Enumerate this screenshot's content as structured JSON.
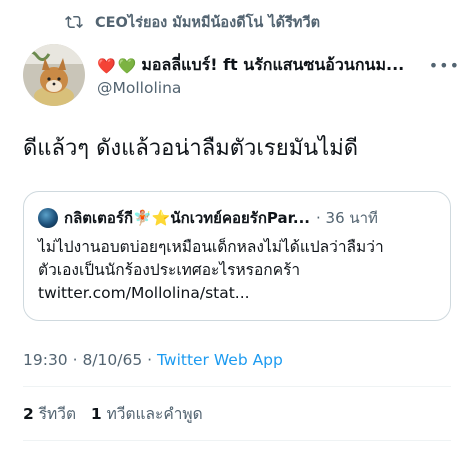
{
  "retweet": {
    "label": "CEOไร่ยอง มัมหมีน้องดีโน่ ได้รีทวีต"
  },
  "author": {
    "emoji_1": "❤️",
    "emoji_2": "💚",
    "name": "มอลลี่แบร์! ft นรักแสนซนอ้วนกนม...",
    "handle": "@Mollolina"
  },
  "tweet": {
    "text": "ดีแล้วๆ ดังแล้วอน่าลืมตัวเรยมันไม่ดี"
  },
  "quote": {
    "name": "กลิตเตอร์กี🧚🏼⭐นักเวทย์คอยรักPar...",
    "time": "· 36 นาที",
    "line_1": "ไม่ไปงานอบตบ่อยๆเหมือนเด็กหลงไม่ได้แปลว่าลืมว่า",
    "line_2": "ตัวเองเป็นนักร้องประเทศอะไรหรอกคร้า",
    "line_3": "twitter.com/Mollolina/stat..."
  },
  "meta": {
    "time": "19:30 · 8/10/65 · ",
    "app": "Twitter Web App"
  },
  "stats": {
    "retweets_count": "2",
    "retweets_label": "รีทวีต",
    "quotes_count": "1",
    "quotes_label": "ทวีตและคำพูด"
  },
  "icons": {
    "retweet": "retweet-icon",
    "more": "more-icon"
  },
  "colors": {
    "accent": "#1d9bf0",
    "muted": "#536471",
    "text": "#0f1419",
    "border": "#cfd9de"
  }
}
